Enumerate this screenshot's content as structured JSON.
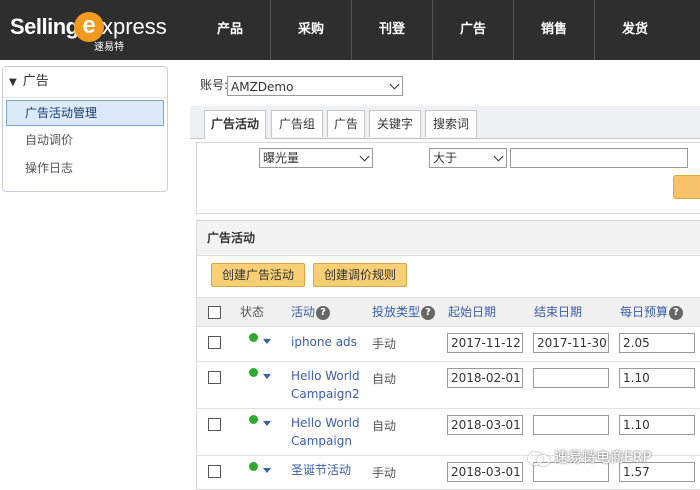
{
  "logo": {
    "word1": "Selling",
    "x": "e",
    "word2": "xpress",
    "cn": "速易特"
  },
  "nav": [
    "产品",
    "采购",
    "刊登",
    "广告",
    "销售",
    "发货"
  ],
  "sidebar": {
    "header": "广告",
    "items": [
      {
        "label": "广告活动管理",
        "active": true
      },
      {
        "label": "自动调价",
        "active": false
      },
      {
        "label": "操作日志",
        "active": false
      }
    ]
  },
  "account": {
    "label": "账号:",
    "value": "AMZDemo"
  },
  "tabs": [
    "广告活动",
    "广告组",
    "广告",
    "关键字",
    "搜索词"
  ],
  "filter": {
    "metric": "曝光量",
    "operator": "大于",
    "value": ""
  },
  "panel": {
    "title": "广告活动",
    "create_campaign": "创建广告活动",
    "create_rule": "创建调价规则"
  },
  "table": {
    "headers": {
      "status": "状态",
      "campaign": "活动",
      "targeting": "投放类型",
      "start": "起始日期",
      "end": "结束日期",
      "budget": "每日预算"
    },
    "rows": [
      {
        "name": [
          "iphone ads"
        ],
        "type": "手动",
        "start": "2017-11-12",
        "end": "2017-11-30",
        "budget": "2.05"
      },
      {
        "name": [
          "Hello World",
          "Campaign2"
        ],
        "type": "自动",
        "start": "2018-02-01",
        "end": "",
        "budget": "1.10"
      },
      {
        "name": [
          "Hello World",
          "Campaign"
        ],
        "type": "自动",
        "start": "2018-03-01",
        "end": "",
        "budget": "1.10"
      },
      {
        "name": [
          "圣诞节活动"
        ],
        "type": "手动",
        "start": "2018-03-01",
        "end": "",
        "budget": "1.57"
      }
    ]
  },
  "watermark": "速易特电商ERP",
  "colors": {
    "topbar": "#2e2e2e",
    "accent": "#f19a1c",
    "link": "#3a5ea8",
    "status_active": "#2eaa2e"
  }
}
